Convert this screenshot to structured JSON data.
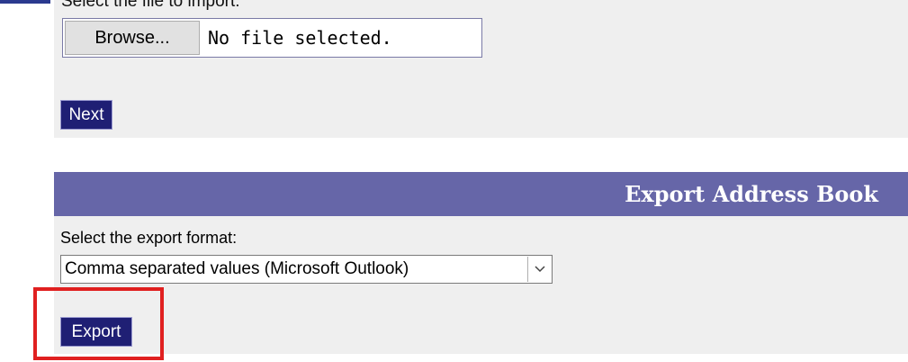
{
  "import_section": {
    "prompt_label": "Select the file to import:",
    "browse_label": "Browse...",
    "file_status": "No file selected.",
    "next_label": "Next"
  },
  "export_section": {
    "title": "Export Address Book",
    "format_label": "Select the export format:",
    "format_selected": "Comma separated values (Microsoft Outlook)",
    "export_label": "Export"
  },
  "icons": {
    "dropdown": "chevron-down-icon"
  },
  "colors": {
    "header_background": "#6666a8",
    "panel_background": "#efefef",
    "button_background": "#1f1f74",
    "highlight": "#e02020"
  }
}
